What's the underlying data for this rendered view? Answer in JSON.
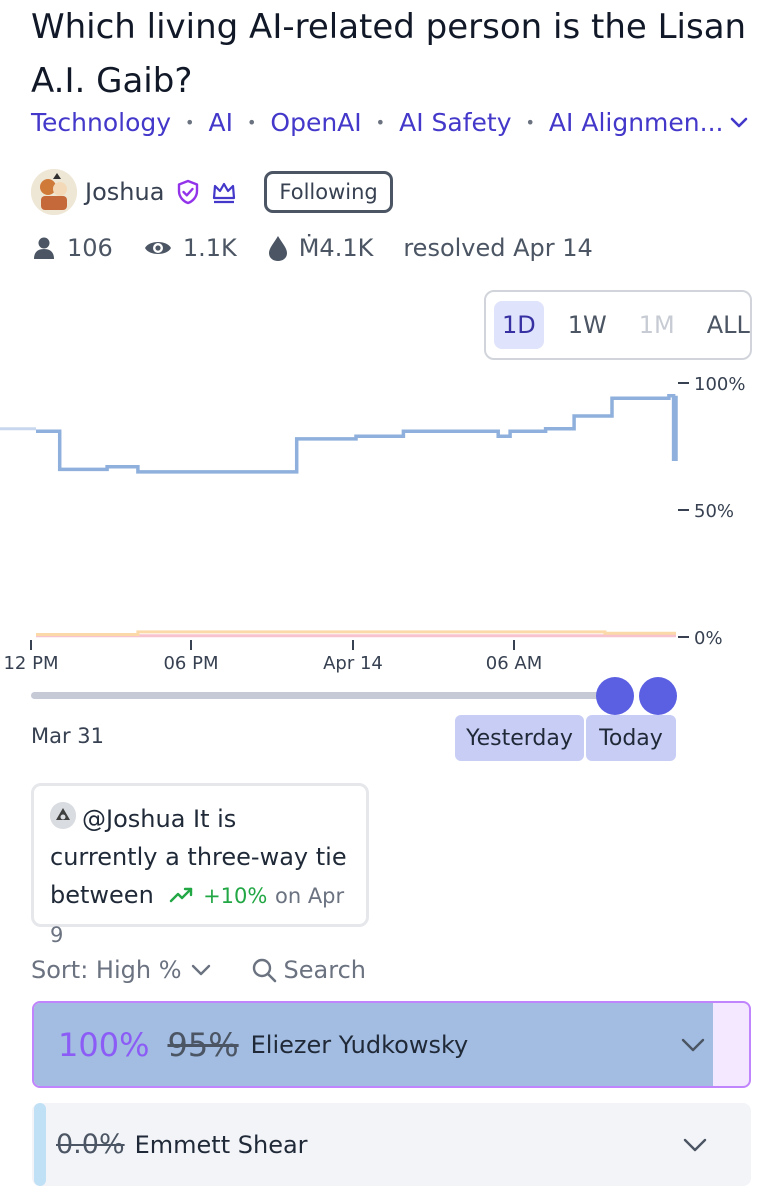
{
  "question": {
    "title": "Which living AI-related person is the Lisan A.I. Gaib?"
  },
  "tags": [
    "Technology",
    "AI",
    "OpenAI",
    "AI Safety",
    "AI Alignmen..."
  ],
  "tag_separator": "•",
  "author": {
    "name": "Joshua",
    "follow_label": "Following",
    "icons": [
      "verified-shield-icon",
      "crown-icon"
    ]
  },
  "stats": {
    "traders": "106",
    "views": "1.1K",
    "volume": "Ṁ4.1K",
    "status": "resolved Apr 14"
  },
  "time_range": {
    "options": [
      "1D",
      "1W",
      "1M",
      "ALL"
    ],
    "selected": "1D",
    "disabled": [
      "1M"
    ]
  },
  "chart_data": {
    "type": "line",
    "x_ticks": [
      "12 PM",
      "06 PM",
      "Apr 14",
      "06 AM"
    ],
    "y_ticks": [
      "100%",
      "50%",
      "0%"
    ],
    "ylim": [
      0,
      100
    ],
    "series": [
      {
        "name": "Eliezer Yudkowsky",
        "color": "#8fb0dc",
        "points": [
          [
            0,
            81
          ],
          [
            1,
            81
          ],
          [
            1,
            66
          ],
          [
            3,
            66
          ],
          [
            3,
            67
          ],
          [
            4.3,
            67
          ],
          [
            4.3,
            65
          ],
          [
            11,
            65
          ],
          [
            11,
            78
          ],
          [
            13.5,
            78
          ],
          [
            13.5,
            79
          ],
          [
            15.5,
            79
          ],
          [
            15.5,
            81
          ],
          [
            19.5,
            81
          ],
          [
            19.5,
            79
          ],
          [
            20,
            79
          ],
          [
            20,
            81
          ],
          [
            21.5,
            81
          ],
          [
            21.5,
            82
          ],
          [
            22.7,
            82
          ],
          [
            22.7,
            87
          ],
          [
            24.3,
            87
          ],
          [
            24.3,
            94
          ],
          [
            26.7,
            94
          ],
          [
            26.7,
            95
          ],
          [
            26.9,
            95
          ],
          [
            26.9,
            70
          ],
          [
            27,
            70
          ],
          [
            27,
            95
          ]
        ]
      },
      {
        "name": "Emmett Shear",
        "color": "#fbd9a8",
        "points": [
          [
            0,
            1
          ],
          [
            4.3,
            1
          ],
          [
            4.3,
            2
          ],
          [
            24,
            2
          ],
          [
            24,
            1.5
          ],
          [
            27,
            1.5
          ]
        ]
      },
      {
        "name": "",
        "color": "#f7c3cf",
        "points": [
          [
            0,
            0.5
          ],
          [
            27,
            0.5
          ]
        ]
      }
    ]
  },
  "timeline": {
    "start_label": "Mar 31",
    "yesterday_label": "Yesterday",
    "today_label": "Today"
  },
  "comment": {
    "text": "@Joshua It is currently a three-way tie between",
    "trend": "+10%",
    "trend_date": "on Apr 9"
  },
  "sort": {
    "label": "Sort: High %",
    "search_label": "Search"
  },
  "answers": [
    {
      "pct": "100%",
      "prev_pct": "95%",
      "name": "Eliezer Yudkowsky",
      "fill_color": "#a3bce1"
    },
    {
      "pct": "0.0%",
      "name": "Emmett Shear",
      "fill_color": "#bfe0f5"
    }
  ]
}
